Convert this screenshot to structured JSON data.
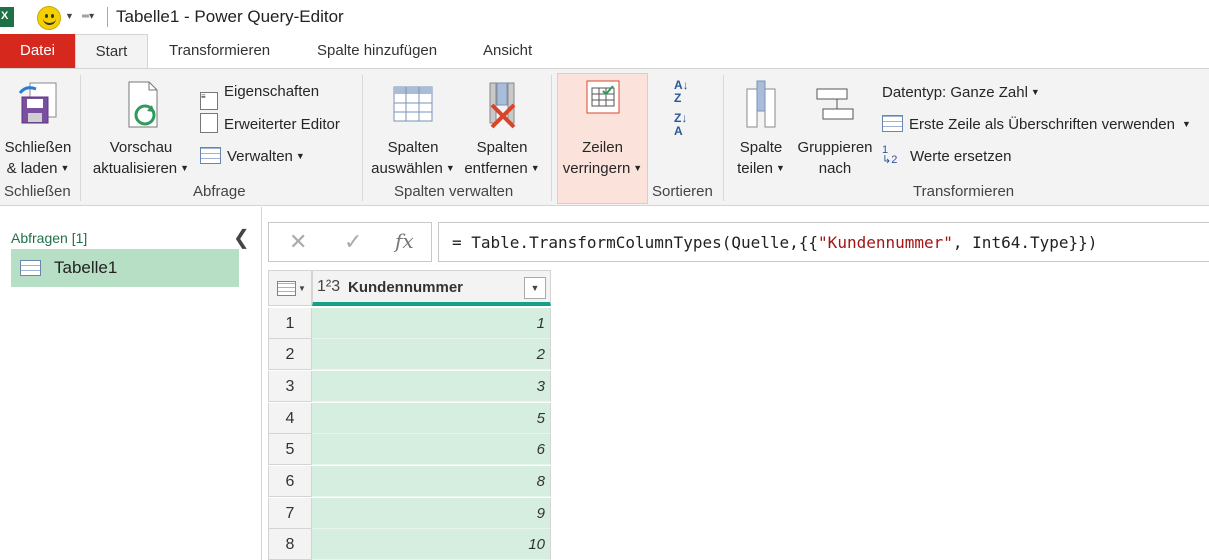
{
  "window": {
    "title": "Tabelle1 - Power Query-Editor",
    "app_icon_letter": "X"
  },
  "tabs": [
    {
      "label": "Datei"
    },
    {
      "label": "Start"
    },
    {
      "label": "Transformieren"
    },
    {
      "label": "Spalte hinzufügen"
    },
    {
      "label": "Ansicht"
    }
  ],
  "ribbon": {
    "schliessen": {
      "line1": "Schließen",
      "line2": "& laden",
      "group": "Schließen"
    },
    "abfrage": {
      "vorschau1": "Vorschau",
      "vorschau2": "aktualisieren",
      "eigenschaften": "Eigenschaften",
      "erweiterter_editor": "Erweiterter Editor",
      "verwalten": "Verwalten",
      "group": "Abfrage"
    },
    "spalten_verwalten": {
      "auswaehlen1": "Spalten",
      "auswaehlen2": "auswählen",
      "entfernen1": "Spalten",
      "entfernen2": "entfernen",
      "group": "Spalten verwalten"
    },
    "zeilen": {
      "line1": "Zeilen",
      "line2": "verringern"
    },
    "sortieren": {
      "group": "Sortieren"
    },
    "transformieren": {
      "teilen1": "Spalte",
      "teilen2": "teilen",
      "gruppieren1": "Gruppieren",
      "gruppieren2": "nach",
      "datentyp": "Datentyp: Ganze Zahl",
      "erste_zeile": "Erste Zeile als Überschriften verwenden",
      "werte_ersetzen": "Werte ersetzen",
      "group": "Transformieren"
    }
  },
  "queries": {
    "header": "Abfragen [1]",
    "items": [
      {
        "label": "Tabelle1"
      }
    ]
  },
  "formula": {
    "prefix": "= Table.TransformColumnTypes(Quelle,{{",
    "string": "\"Kundennummer\"",
    "suffix": ", Int64.Type}})",
    "fx": "fx"
  },
  "grid": {
    "column": {
      "type_icon": "1²3",
      "name": "Kundennummer"
    },
    "rows": [
      {
        "n": "1",
        "v": "1"
      },
      {
        "n": "2",
        "v": "2"
      },
      {
        "n": "3",
        "v": "3"
      },
      {
        "n": "4",
        "v": "5"
      },
      {
        "n": "5",
        "v": "6"
      },
      {
        "n": "6",
        "v": "8"
      },
      {
        "n": "7",
        "v": "9"
      },
      {
        "n": "8",
        "v": "10"
      }
    ]
  },
  "colors": {
    "datei_tab": "#d6281d",
    "accent": "#16a085",
    "selection": "#b7dfc6",
    "cell_bg": "#d5eee0"
  }
}
